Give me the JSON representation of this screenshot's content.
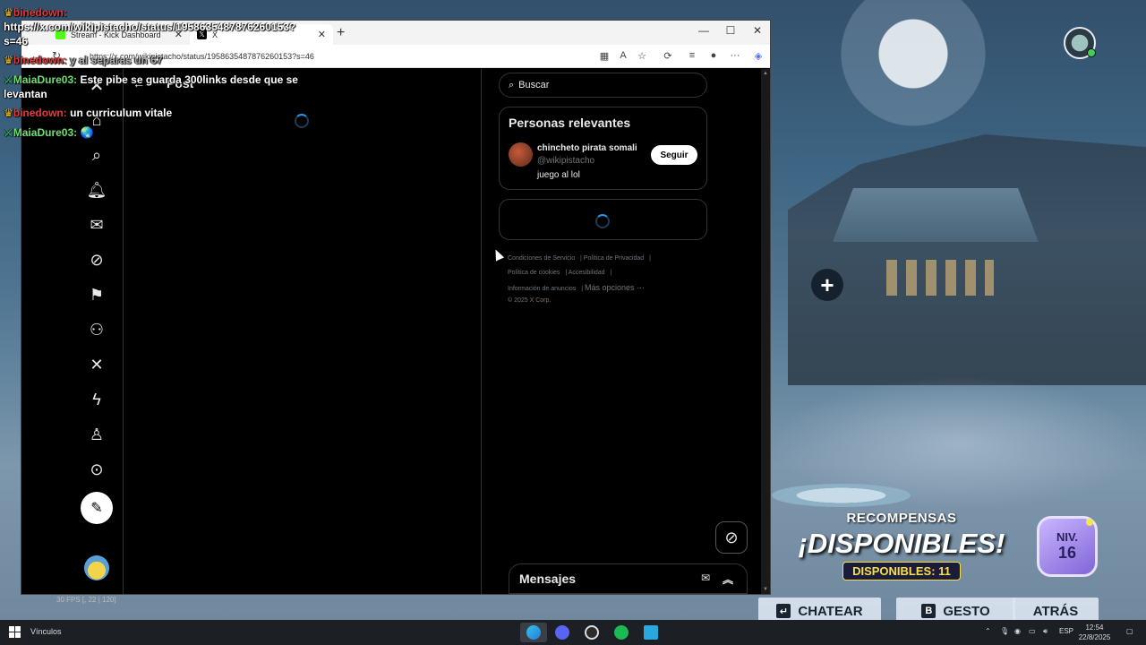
{
  "browser": {
    "tabs": [
      {
        "label": "Stream - Kick Dashboard",
        "icon": "kick-icon"
      },
      {
        "label": "X",
        "icon": "x-icon"
      }
    ],
    "new_tab_label": "+",
    "url": "https://x.com/wikipistacho/status/1958635487876260153?s=46"
  },
  "x": {
    "post_title": "Post",
    "search_placeholder": "Buscar",
    "relevant_title": "Personas relevantes",
    "person": {
      "name": "chincheto pirata somali",
      "handle": "@wikipistacho",
      "bio": "juego al lol",
      "follow_label": "Seguir"
    },
    "footer": {
      "terms": "Condiciones de Servicio",
      "privacy": "Política de Privacidad",
      "cookies": "Política de cookies",
      "accessibility": "Accesibilidad",
      "ads": "Información de anuncios",
      "more": "Más opciones ···",
      "copyright": "© 2025 X Corp."
    },
    "messages_label": "Mensajes",
    "sidebar_icons": [
      "x-logo-icon",
      "home-icon",
      "search-icon",
      "bell-icon",
      "mail-icon",
      "grok-icon",
      "bookmark-icon",
      "communities-icon",
      "premium-icon",
      "lightning-icon",
      "profile-icon",
      "more-icon"
    ]
  },
  "chat": [
    {
      "user": "binedown:",
      "text": "https://x.com/wikipistacho/status/1958635487876260153?s=46",
      "user_color": "#e53a3a"
    },
    {
      "user": "binedown:",
      "text": "y al separas un 67",
      "user_color": "#e53a3a"
    },
    {
      "user": "MaiaDure03:",
      "text": "Este pibe se guarda 300links desde que se levantan",
      "user_color": "#6fe06f"
    },
    {
      "user": "binedown:",
      "text": "un curriculum vitale",
      "user_color": "#e53a3a"
    },
    {
      "user": "MaiaDure03:",
      "text": "🌏",
      "user_color": "#6fe06f"
    }
  ],
  "stats": {
    "fps": "30 FPS [, 22 | 120]"
  },
  "game": {
    "rewards_title": "RECOMPENSAS",
    "rewards_big": "¡DISPONIBLES!",
    "rewards_count": "DISPONIBLES: 11",
    "level_label": "NIV.",
    "level_value": "16",
    "buttons": {
      "chat": "CHATEAR",
      "gesture": "GESTO",
      "back": "ATRÁS"
    },
    "plus": "+"
  },
  "taskbar": {
    "label": "Vínculos",
    "lang": "ESP",
    "time": "12:54",
    "date": "22/8/2025"
  }
}
